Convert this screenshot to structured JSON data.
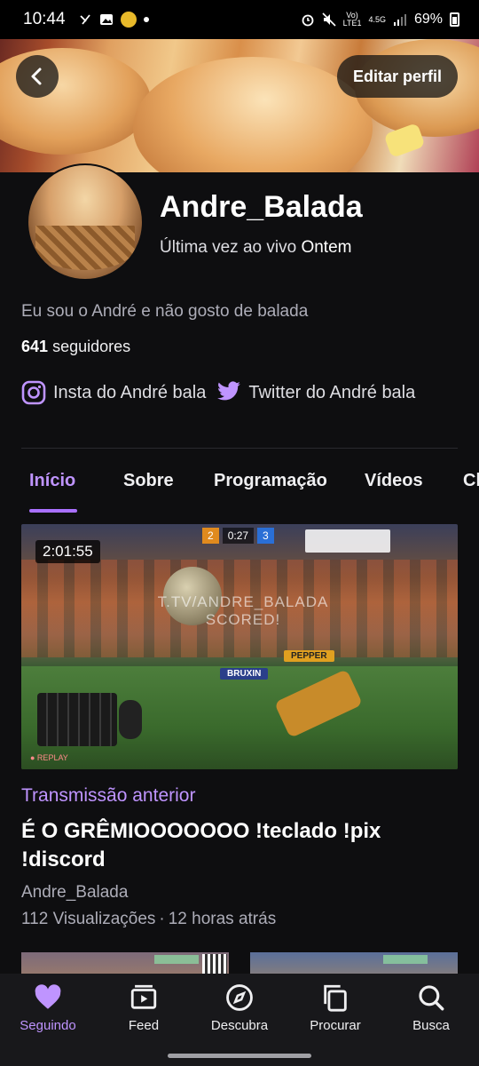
{
  "status_bar": {
    "time": "10:44",
    "network_top": "Vo)",
    "network_bottom": "LTE1",
    "data_type": "4.5G",
    "battery": "69%"
  },
  "header": {
    "back_icon": "chevron-left-icon",
    "edit_profile_label": "Editar perfil"
  },
  "profile": {
    "username": "Andre_Balada",
    "last_live_prefix": "Última vez ao vivo",
    "last_live_value": "Ontem",
    "bio": "Eu sou o André e não gosto de balada",
    "followers_count": "641",
    "followers_label": "seguidores",
    "links": [
      {
        "icon": "instagram-icon",
        "label": "Insta do André bala"
      },
      {
        "icon": "twitter-icon",
        "label": "Twitter do André bala"
      }
    ]
  },
  "tabs": [
    {
      "label": "Início",
      "active": true
    },
    {
      "label": "Sobre",
      "active": false
    },
    {
      "label": "Programação",
      "active": false
    },
    {
      "label": "Vídeos",
      "active": false
    },
    {
      "label": "Cl",
      "active": false
    }
  ],
  "video": {
    "duration": "2:01:55",
    "thumbnail_overlay_text": "T.TV/ANDRE_BALADA SCORED!",
    "score_left": "2",
    "score_clock": "0:27",
    "score_right": "3",
    "player_orange": "PEPPER",
    "player_blue": "BRUXIN",
    "replay_label": "● REPLAY",
    "type_label": "Transmissão anterior",
    "title": "É O GRÊMIOOOOOOO !teclado !pix !discord",
    "channel": "Andre_Balada",
    "views": "112 Visualizações",
    "separator": "·",
    "time_ago": "12 horas atrás"
  },
  "bottom_nav": [
    {
      "label": "Seguindo",
      "icon": "heart-icon",
      "active": true
    },
    {
      "label": "Feed",
      "icon": "feed-icon",
      "active": false
    },
    {
      "label": "Descubra",
      "icon": "compass-icon",
      "active": false
    },
    {
      "label": "Procurar",
      "icon": "browse-icon",
      "active": false
    },
    {
      "label": "Busca",
      "icon": "search-icon",
      "active": false
    }
  ],
  "colors": {
    "accent": "#bf94ff",
    "accent_strong": "#a970ff",
    "background": "#0e0e10",
    "nav_background": "#18181b"
  }
}
